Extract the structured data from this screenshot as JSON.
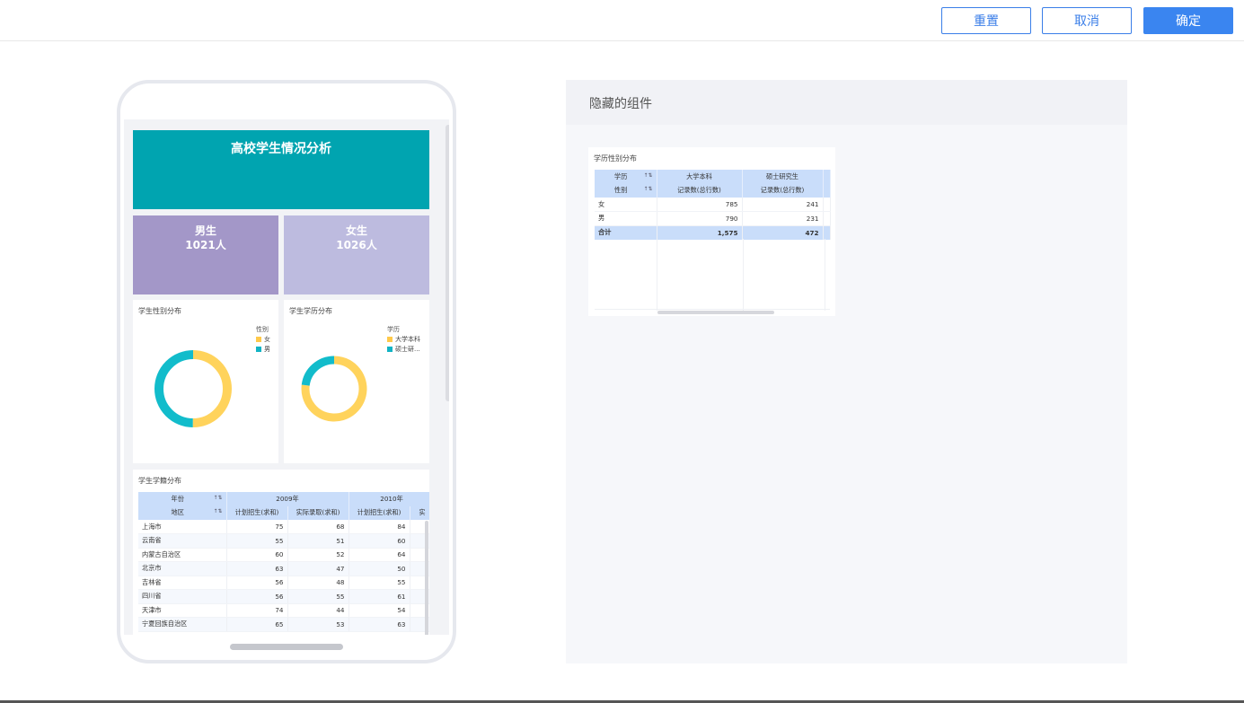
{
  "toolbar": {
    "reset_label": "重置",
    "cancel_label": "取消",
    "confirm_label": "确定"
  },
  "colors": {
    "accent": "#3a85f0",
    "teal": "#00a4b0",
    "male_card": "#a397c8",
    "female_card": "#bdbbdf",
    "ring_yellow": "#ffd35c",
    "ring_teal": "#12bccb",
    "header_blue": "#c9ddfa"
  },
  "mobile": {
    "title": "高校学生情况分析",
    "male": {
      "label": "男生",
      "value": "1021人"
    },
    "female": {
      "label": "女生",
      "value": "1026人"
    },
    "gender_chart": {
      "title": "学生性别分布",
      "legend_title": "性别",
      "legend": [
        "女",
        "男"
      ]
    },
    "degree_chart": {
      "title": "学生学历分布",
      "legend_title": "学历",
      "legend": [
        "大学本科",
        "硕士研..."
      ]
    },
    "origin_table": {
      "title": "学生学籍分布",
      "row_dim_1": "年份",
      "row_dim_2": "地区",
      "years": [
        "2009年",
        "2010年"
      ],
      "measures": [
        "计划招生(求和)",
        "实际录取(求和)",
        "计划招生(求和)",
        "实"
      ],
      "rows": [
        {
          "region": "上海市",
          "v1": "75",
          "v2": "68",
          "v3": "84"
        },
        {
          "region": "云南省",
          "v1": "55",
          "v2": "51",
          "v3": "60"
        },
        {
          "region": "内蒙古自治区",
          "v1": "60",
          "v2": "52",
          "v3": "64"
        },
        {
          "region": "北京市",
          "v1": "63",
          "v2": "47",
          "v3": "50"
        },
        {
          "region": "吉林省",
          "v1": "56",
          "v2": "48",
          "v3": "55"
        },
        {
          "region": "四川省",
          "v1": "56",
          "v2": "55",
          "v3": "61"
        },
        {
          "region": "天津市",
          "v1": "74",
          "v2": "44",
          "v3": "54"
        },
        {
          "region": "宁夏回族自治区",
          "v1": "65",
          "v2": "53",
          "v3": "63"
        }
      ]
    }
  },
  "chart_data": [
    {
      "type": "pie",
      "title": "学生性别分布",
      "legend_title": "性别",
      "labels": [
        "女",
        "男"
      ],
      "values": [
        1026,
        1021
      ],
      "legend_placement": "top-right",
      "style": "donut"
    },
    {
      "type": "pie",
      "title": "学生学历分布",
      "legend_title": "学历",
      "labels": [
        "大学本科",
        "硕士研..."
      ],
      "values": [
        1575,
        472
      ],
      "legend_placement": "top-right",
      "style": "donut"
    }
  ],
  "hidden_panel": {
    "title": "隐藏的组件",
    "table": {
      "title": "学历性别分布",
      "dim_1": "学历",
      "dim_2": "性别",
      "columns": [
        "大学本科",
        "硕士研究生"
      ],
      "measure": "记录数(总行数)",
      "rows": [
        {
          "label": "女",
          "c1": "785",
          "c2": "241"
        },
        {
          "label": "男",
          "c1": "790",
          "c2": "231"
        }
      ],
      "total": {
        "label": "合计",
        "c1": "1,575",
        "c2": "472"
      }
    }
  }
}
